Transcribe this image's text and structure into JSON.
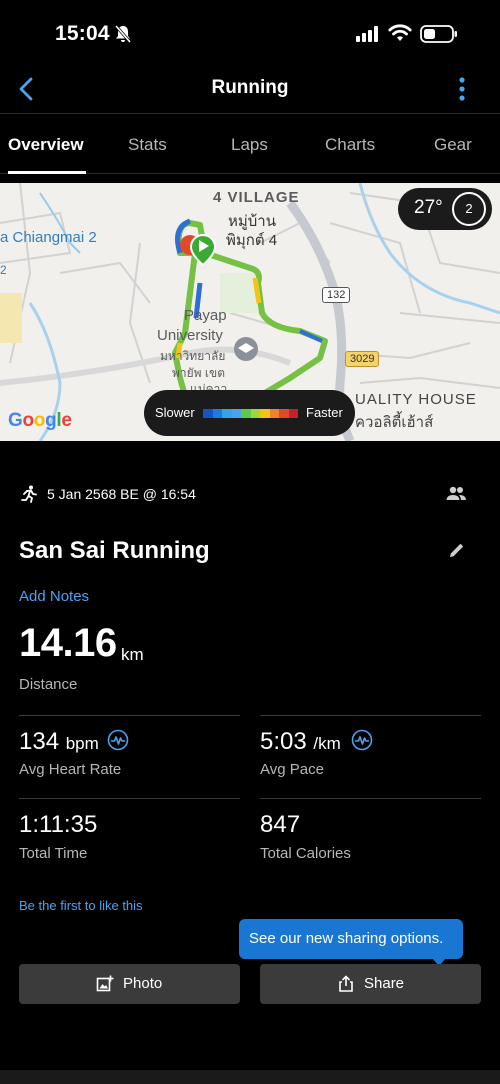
{
  "status_bar": {
    "time": "15:04"
  },
  "nav": {
    "title": "Running"
  },
  "tabs": [
    {
      "label": "Overview",
      "active": true
    },
    {
      "label": "Stats"
    },
    {
      "label": "Laps"
    },
    {
      "label": "Charts"
    },
    {
      "label": "Gear"
    }
  ],
  "map": {
    "labels": {
      "village": "4 VILLAGE",
      "village_thai_1": "หมู่บ้าน",
      "village_thai_2": "พิมุกต์ 4",
      "chiangmai": "a Chiangmai 2",
      "left_edge": "2",
      "university_1": "Payap",
      "university_2": "University",
      "university_thai_1": "มหาวิทยาลัย",
      "university_thai_2": "พายัพ เขต",
      "university_thai_3": "แม่คาว",
      "quality_house": "UALITY HOUSE",
      "quality_house_thai": "ควอลิตี้เฮ้าส์",
      "route_132": "132",
      "route_3029": "3029"
    },
    "temperature": "27°",
    "temperature_badge_number": "2",
    "legend": {
      "slower": "Slower",
      "faster": "Faster"
    },
    "legend_colors": [
      "#1455c4",
      "#1d7ae0",
      "#35a4e6",
      "#4aa3ee",
      "#5ec94c",
      "#9ed63c",
      "#f2c417",
      "#f0822b",
      "#e04a28",
      "#c8202a"
    ],
    "google": "Google"
  },
  "activity": {
    "date": "5 Jan 2568 BE @ 16:54",
    "title": "San Sai Running",
    "add_notes": "Add Notes",
    "distance": {
      "value": "14.16",
      "unit": "km",
      "label": "Distance"
    },
    "heart_rate": {
      "value": "134",
      "unit": "bpm",
      "label": "Avg Heart Rate"
    },
    "pace": {
      "value": "5:03",
      "unit": "/km",
      "label": "Avg Pace"
    },
    "total_time": {
      "value": "1:11:35",
      "label": "Total Time"
    },
    "calories": {
      "value": "847",
      "label": "Total Calories"
    },
    "like_text": "Be the first to like this"
  },
  "tooltip": "See our new sharing options.",
  "buttons": {
    "photo": "Photo",
    "share": "Share"
  },
  "colors": {
    "accent_blue": "#4aa3ee",
    "tooltip_blue": "#1977d3",
    "button_bg": "#3b3b3b"
  }
}
